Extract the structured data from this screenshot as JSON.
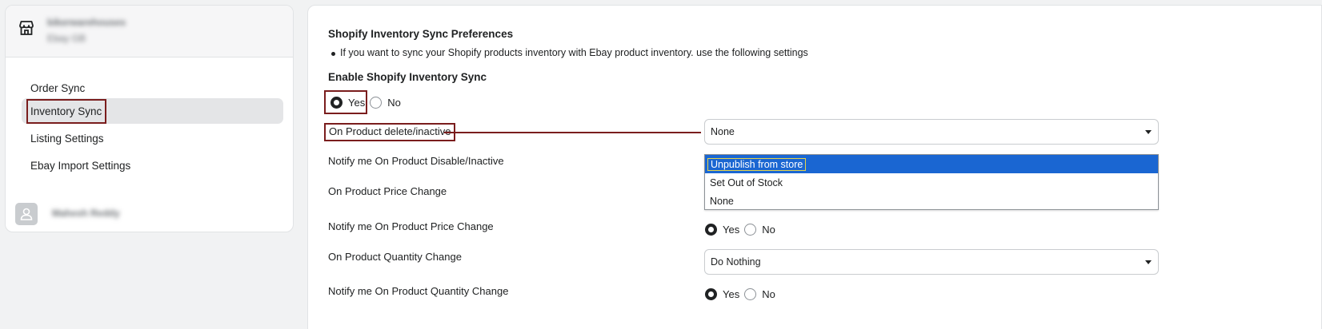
{
  "sidebar": {
    "store_name": "bikerwarehouses",
    "store_sub": "Ebay GB",
    "items": [
      {
        "label": "Order Sync"
      },
      {
        "label": "Inventory Sync"
      },
      {
        "label": "Listing Settings"
      },
      {
        "label": "Ebay Import Settings"
      }
    ],
    "user_name": "Mahesh Reddy"
  },
  "main": {
    "title": "Shopify Inventory Sync Preferences",
    "bullet": "If you want to sync your Shopify products inventory with Ebay product inventory. use the following settings",
    "enable_title": "Enable Shopify Inventory Sync",
    "yes": "Yes",
    "no": "No",
    "fields": {
      "delete_label": "On Product delete/inactive",
      "notify_disable_label": "Notify me On Product Disable/Inactive",
      "price_label": "On Product Price Change",
      "notify_price_label": "Notify me On Product Price Change",
      "qty_label": "On Product Quantity Change",
      "notify_qty_label": "Notify me On Product Quantity Change"
    },
    "delete_select": {
      "value": "None",
      "options": [
        "Unpublish from store",
        "Set Out of Stock",
        "None"
      ]
    },
    "qty_select": {
      "value": "Do Nothing"
    }
  },
  "colors": {
    "annotation": "#7a1d1d",
    "highlight": "#1a66d2"
  }
}
